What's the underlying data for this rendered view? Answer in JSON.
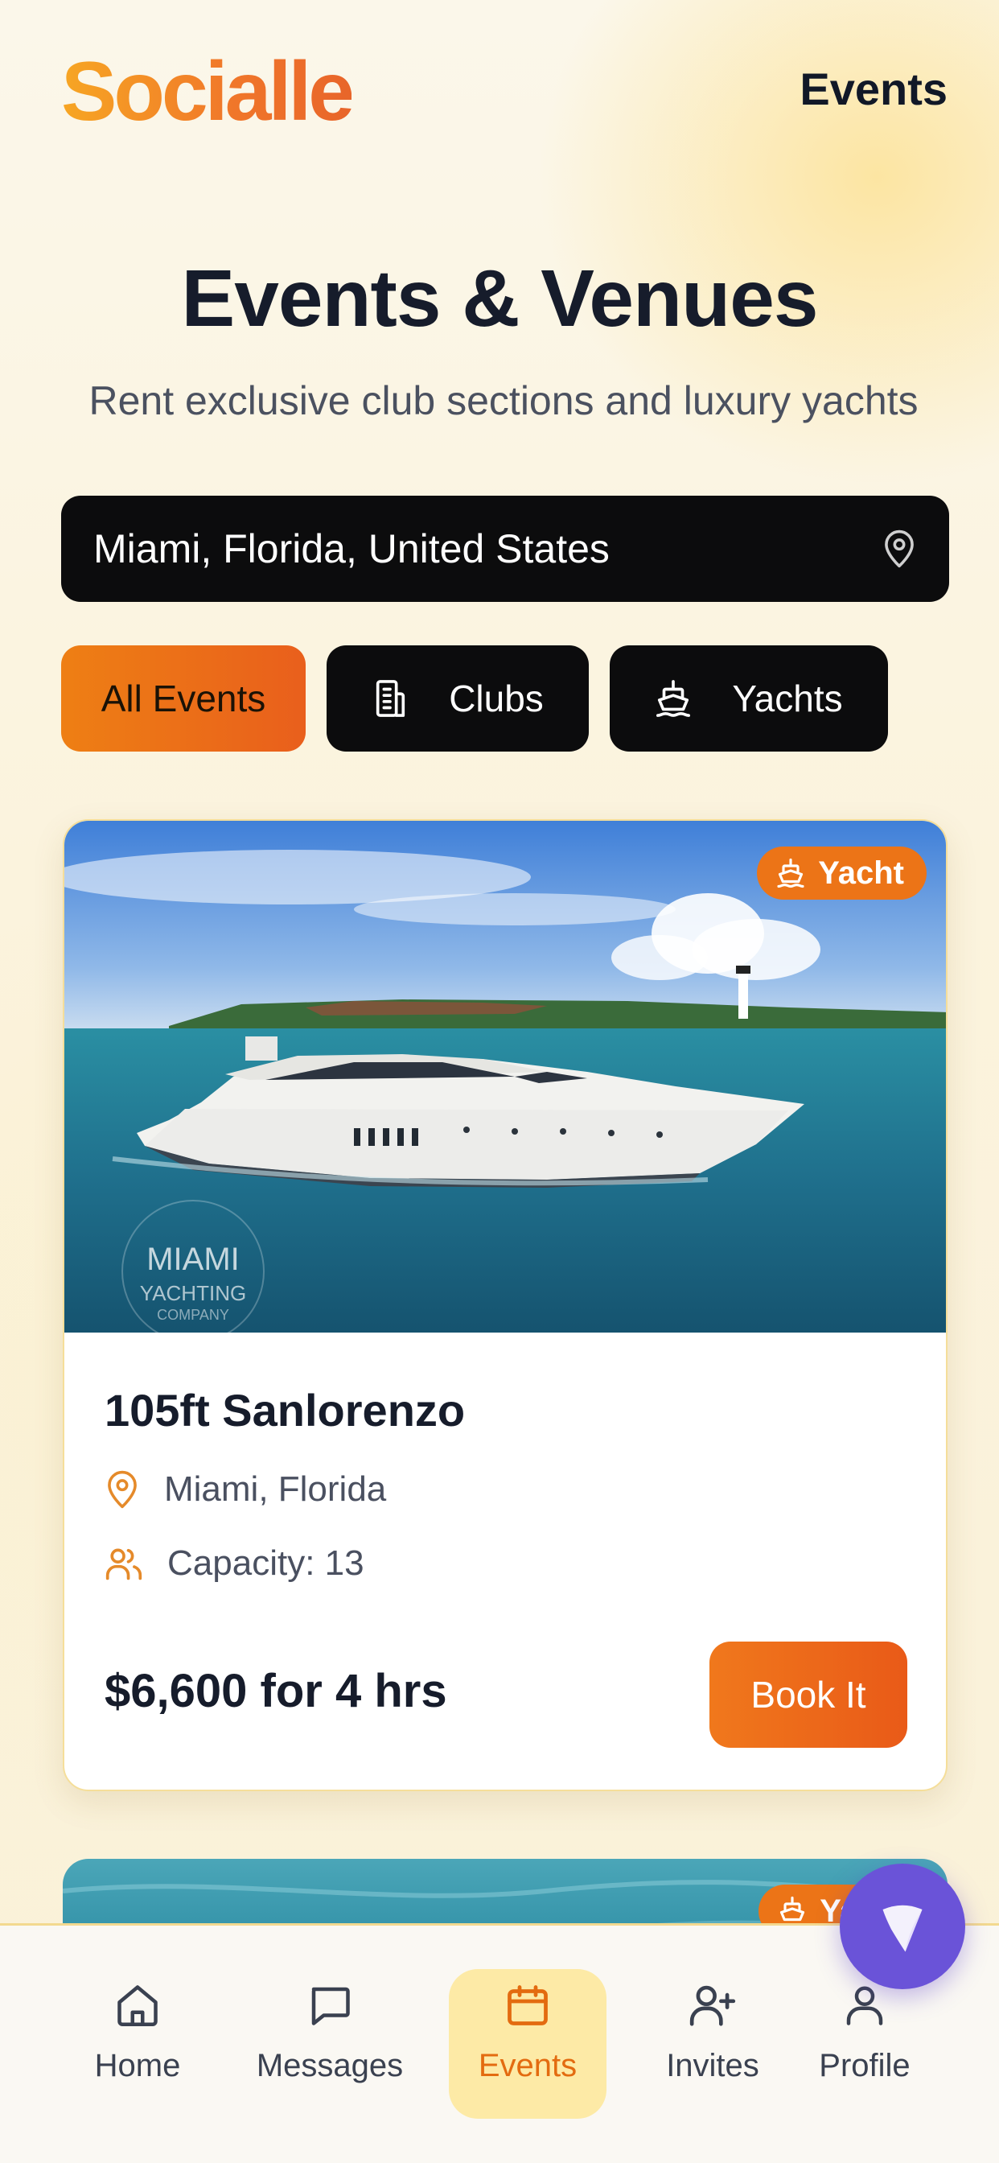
{
  "app": {
    "logo": "Socialle",
    "header_title": "Events"
  },
  "hero": {
    "title": "Events & Venues",
    "subtitle": "Rent exclusive club sections and luxury yachts"
  },
  "location": {
    "value": "Miami, Florida, United States",
    "icon": "map-pin-icon"
  },
  "filters": [
    {
      "label": "All Events",
      "active": true
    },
    {
      "label": "Clubs",
      "icon": "building-icon"
    },
    {
      "label": "Yachts",
      "icon": "ship-icon"
    }
  ],
  "listing": {
    "badge": "Yacht",
    "image_watermark": [
      "MIAMI",
      "YACHTING",
      "COMPANY"
    ],
    "title": "105ft Sanlorenzo",
    "location": "Miami, Florida",
    "capacity": "Capacity: 13",
    "price": "$6,600 for 4 hrs",
    "cta": "Book It"
  },
  "listing2": {
    "badge": "Yacht"
  },
  "nav": [
    {
      "label": "Home",
      "icon": "home-icon"
    },
    {
      "label": "Messages",
      "icon": "message-icon"
    },
    {
      "label": "Events",
      "icon": "calendar-icon",
      "active": true
    },
    {
      "label": "Invites",
      "icon": "user-plus-icon"
    },
    {
      "label": "Profile",
      "icon": "user-icon"
    }
  ],
  "colors": {
    "accent_orange": "#ec7417",
    "dark": "#0c0c0d",
    "fab_purple": "#6a53d8",
    "nav_active_bg": "#fdeaa6"
  }
}
